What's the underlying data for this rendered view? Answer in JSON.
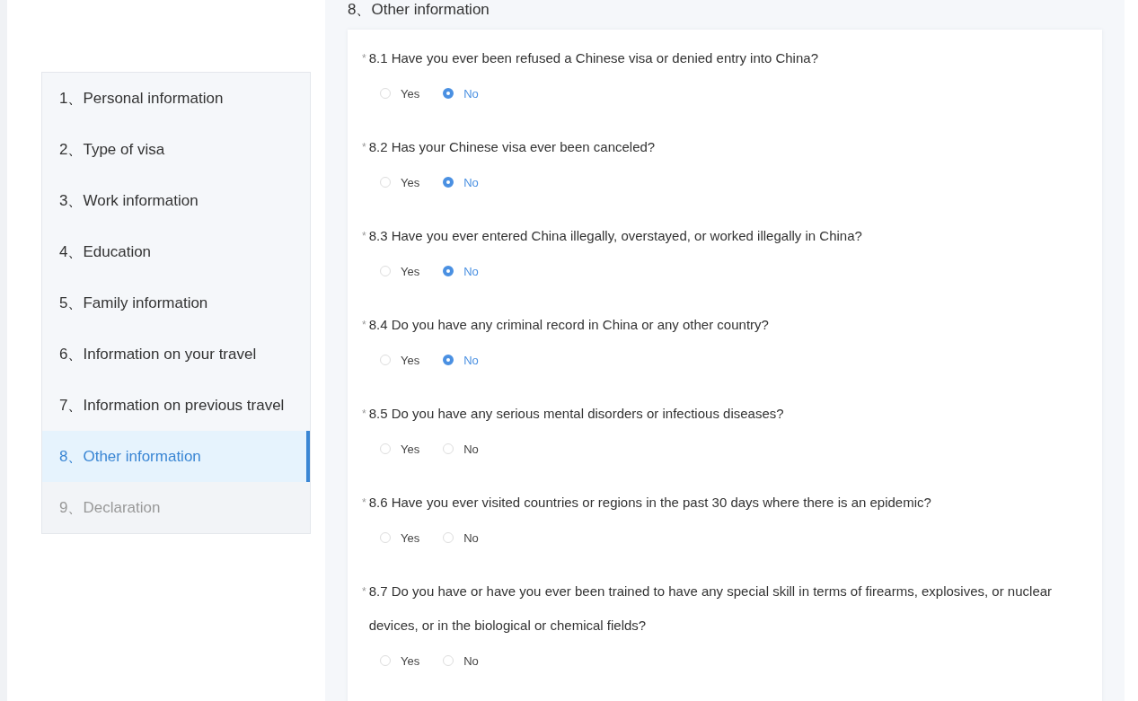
{
  "sidebar": {
    "items": [
      {
        "label": "1、Personal information",
        "selected": false,
        "disabled": false
      },
      {
        "label": "2、Type of visa",
        "selected": false,
        "disabled": false
      },
      {
        "label": "3、Work information",
        "selected": false,
        "disabled": false
      },
      {
        "label": "4、Education",
        "selected": false,
        "disabled": false
      },
      {
        "label": "5、Family information",
        "selected": false,
        "disabled": false
      },
      {
        "label": "6、Information on your travel",
        "selected": false,
        "disabled": false
      },
      {
        "label": "7、Information on previous travel",
        "selected": false,
        "disabled": false
      },
      {
        "label": "8、Other information",
        "selected": true,
        "disabled": false
      },
      {
        "label": "9、Declaration",
        "selected": false,
        "disabled": true
      }
    ]
  },
  "section": {
    "title": "8、Other information",
    "questions": [
      {
        "required_mark": "*",
        "text": "8.1 Have you ever been refused a Chinese visa or denied entry into China?",
        "options": [
          {
            "label": "Yes",
            "selected": false
          },
          {
            "label": "No",
            "selected": true
          }
        ]
      },
      {
        "required_mark": "*",
        "text": "8.2 Has your Chinese visa ever been canceled?",
        "options": [
          {
            "label": "Yes",
            "selected": false
          },
          {
            "label": "No",
            "selected": true
          }
        ]
      },
      {
        "required_mark": "*",
        "text": "8.3 Have you ever entered China illegally, overstayed, or worked illegally in China?",
        "options": [
          {
            "label": "Yes",
            "selected": false
          },
          {
            "label": "No",
            "selected": true
          }
        ]
      },
      {
        "required_mark": "*",
        "text": "8.4 Do you have any criminal record in China or any other country?",
        "options": [
          {
            "label": "Yes",
            "selected": false
          },
          {
            "label": "No",
            "selected": true
          }
        ]
      },
      {
        "required_mark": "*",
        "text": "8.5 Do you have any serious mental disorders or infectious diseases?",
        "options": [
          {
            "label": "Yes",
            "selected": false
          },
          {
            "label": "No",
            "selected": false
          }
        ]
      },
      {
        "required_mark": "*",
        "text": "8.6 Have you ever visited countries or regions in the past 30 days where there is an epidemic?",
        "options": [
          {
            "label": "Yes",
            "selected": false
          },
          {
            "label": "No",
            "selected": false
          }
        ]
      },
      {
        "required_mark": "*",
        "text": "8.7 Do you have or have you ever been trained to have any special skill in terms of firearms, explosives, or nuclear devices, or in the biological or chemical fields?",
        "options": [
          {
            "label": "Yes",
            "selected": false
          },
          {
            "label": "No",
            "selected": false
          }
        ]
      }
    ]
  }
}
